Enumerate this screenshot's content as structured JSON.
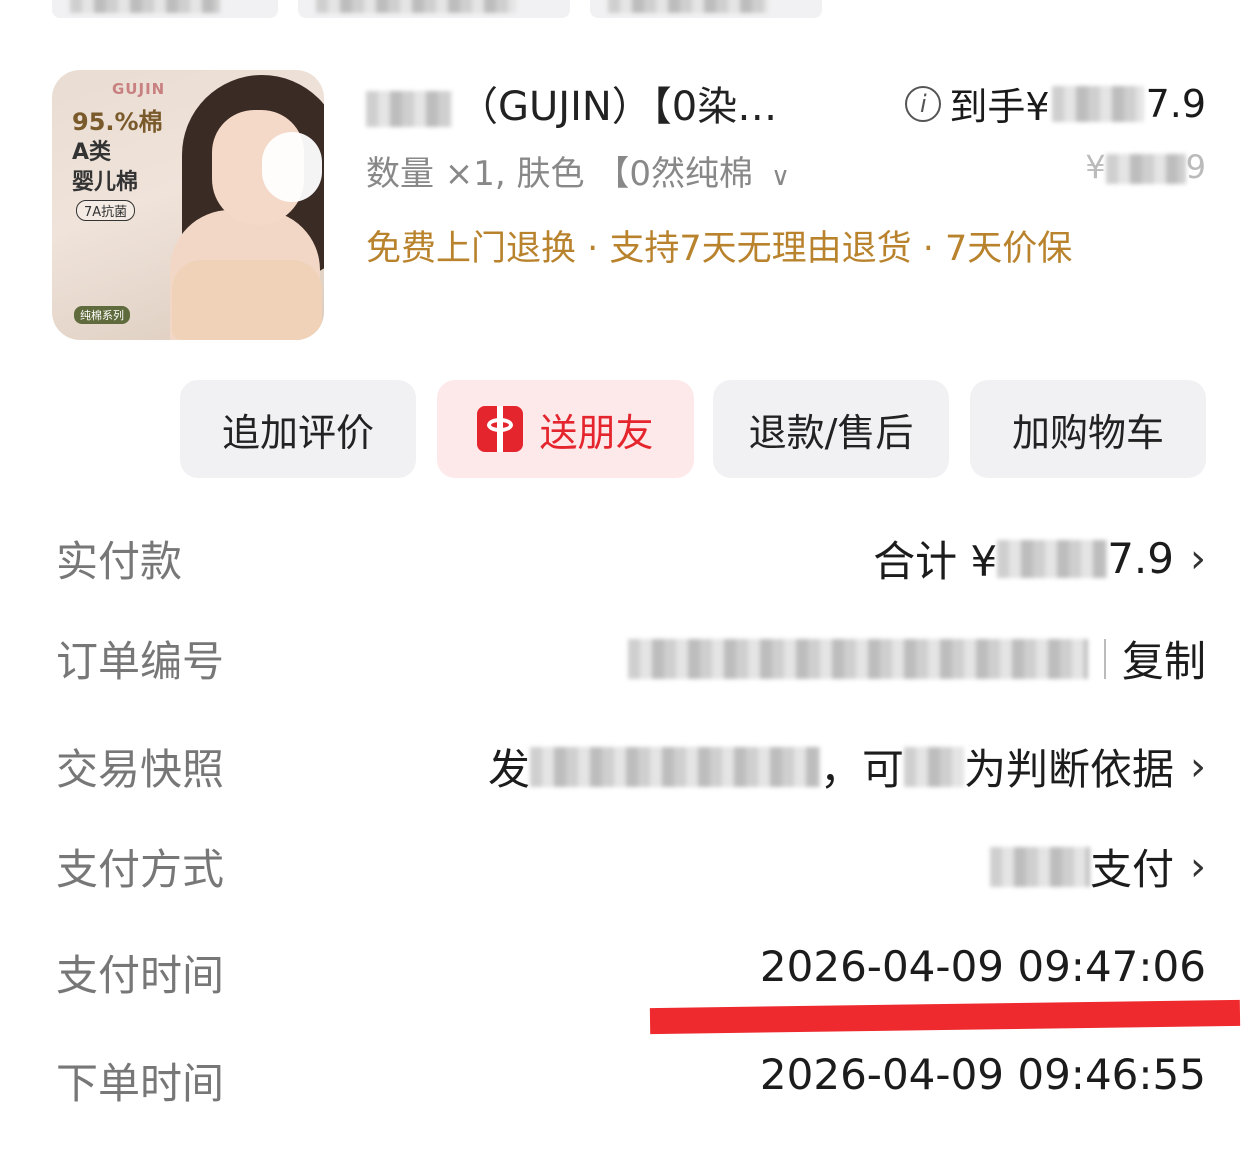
{
  "tags": [
    "",
    "",
    ""
  ],
  "product": {
    "thumb": {
      "brand": "GUJIN",
      "pct": "95.%棉",
      "line1": "A类",
      "line2": "婴儿棉",
      "badge": "7A抗菌",
      "series": "纯棉系列"
    },
    "title": "（GUJIN）【0染…",
    "price_prefix": "到手¥",
    "price_suffix": "7.9",
    "spec": "数量 ×1, 肤色 【0然纯棉",
    "orig_price_prefix": "¥",
    "orig_price_suffix": "9",
    "services": "免费上门退换 · 支持7天无理由退货 · 7天价保"
  },
  "actions": {
    "review": "追加评价",
    "gift": "送朋友",
    "refund": "退款/售后",
    "cart": "加购物车"
  },
  "details": {
    "paid_label": "实付款",
    "paid_value_prefix": "合计 ¥",
    "paid_value_suffix": "7.9",
    "order_label": "订单编号",
    "copy": "复制",
    "snapshot_label": "交易快照",
    "snapshot_value_a": "发",
    "snapshot_value_b": "，可",
    "snapshot_value_c": "为判断依据",
    "paymethod_label": "支付方式",
    "paymethod_value": "支付",
    "paytime_label": "支付时间",
    "paytime_value": "2026-04-09 09:47:06",
    "ordertime_label": "下单时间",
    "ordertime_value": "2026-04-09 09:46:55"
  },
  "colors": {
    "service": "#b9832e",
    "gift": "#e5252d",
    "underline": "#ee2a2e"
  }
}
